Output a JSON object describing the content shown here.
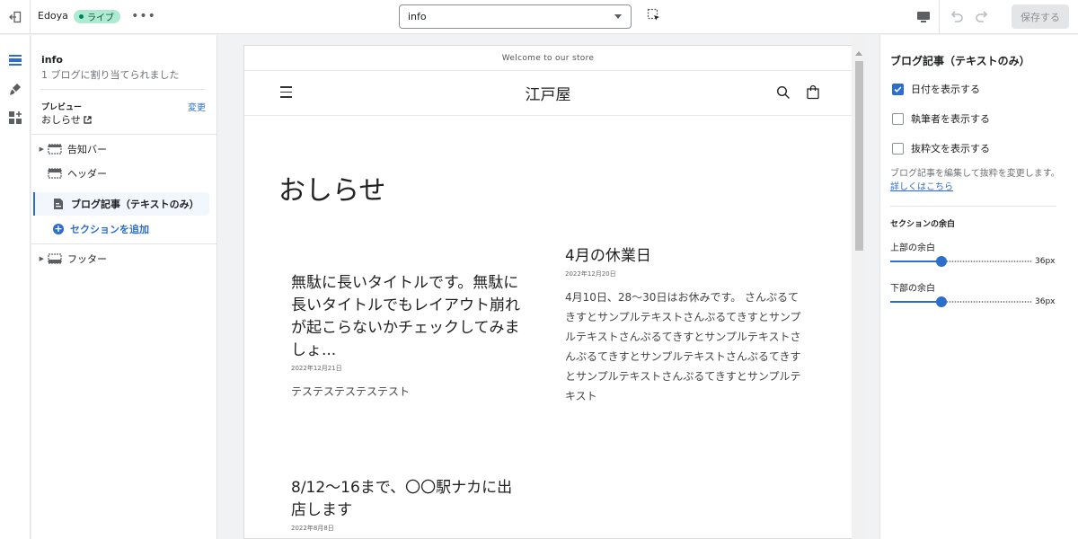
{
  "topbar": {
    "store_name": "Edoya",
    "status_badge": "ライブ",
    "more_label": "•••",
    "page_select_value": "info",
    "save_label": "保存する"
  },
  "sidebar": {
    "title": "info",
    "subtitle": "1 ブログに割り当てられました",
    "preview_label": "プレビュー",
    "preview_change": "変更",
    "preview_value": "おしらせ",
    "items": [
      {
        "label": "告知バー",
        "has_arrow": true
      },
      {
        "label": "ヘッダー",
        "has_arrow": false
      },
      {
        "label": "ブログ記事（テキストのみ）",
        "has_arrow": false,
        "selected": true
      },
      {
        "label": "フッター",
        "has_arrow": true
      }
    ],
    "add_section_label": "セクションを追加"
  },
  "preview": {
    "announcement": "Welcome to our store",
    "logo": "江戸屋",
    "blog_title": "おしらせ",
    "articles": [
      {
        "title": "無駄に長いタイトルです。無駄に長いタイトルでもレイアウト崩れが起こらないかチェックしてみましょ...",
        "date": "2022年12月21日",
        "excerpt": "テステステステステスト"
      },
      {
        "title": "4月の休業日",
        "date": "2022年12月20日",
        "excerpt": "4月10日、28〜30日はお休みです。 さんぷるてきすとサンプルテキストさんぷるてきすとサンプルテキストさんぷるてきすとサンプルテキストさんぷるてきすとサンプルテキストさんぷるてきすとサンプルテキストさんぷるてきすとサンプルテキスト"
      },
      {
        "title": "8/12〜16まで、〇〇駅ナカに出店します",
        "date": "2022年8月8日",
        "excerpt": ""
      }
    ]
  },
  "settings": {
    "title": "ブログ記事（テキストのみ）",
    "checkboxes": [
      {
        "label": "日付を表示する",
        "checked": true
      },
      {
        "label": "執筆者を表示する",
        "checked": false
      },
      {
        "label": "抜粋文を表示する",
        "checked": false
      }
    ],
    "help_text": "ブログ記事を編集して抜粋を変更します。",
    "help_link": "詳しくはこちら",
    "padding_heading": "セクションの余白",
    "top_padding_label": "上部の余白",
    "top_padding_value": "36px",
    "top_padding_fraction": 0.36,
    "bottom_padding_label": "下部の余白",
    "bottom_padding_value": "36px",
    "bottom_padding_fraction": 0.36
  },
  "colors": {
    "accent": "#2c6ecb",
    "live_badge_bg": "#aee9d1"
  }
}
